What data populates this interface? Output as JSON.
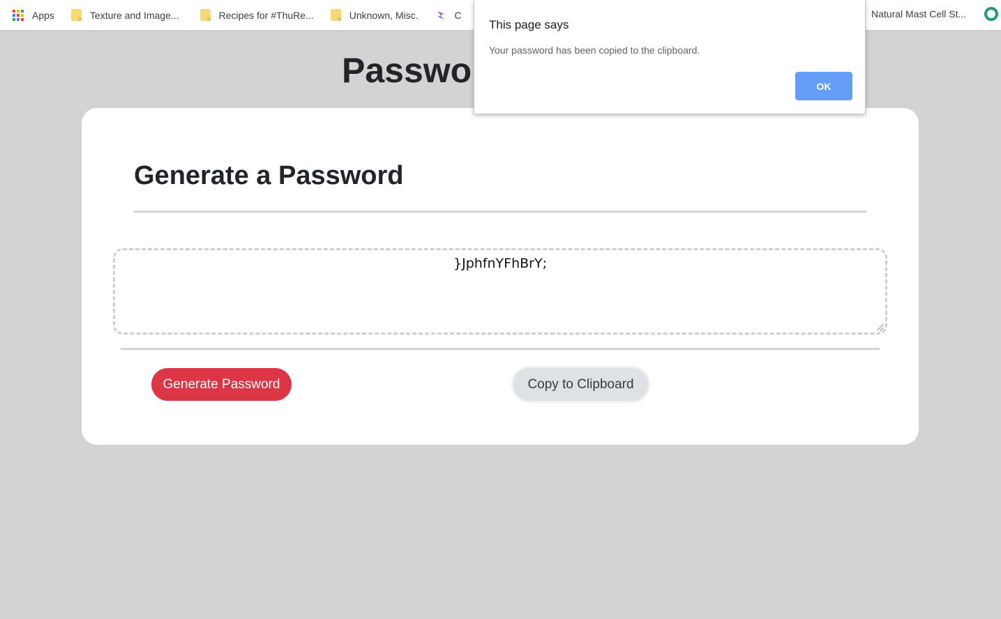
{
  "bookmarks": {
    "items": [
      {
        "label": "Apps",
        "icon": "apps-grid-icon"
      },
      {
        "label": "Texture and Image...",
        "icon": "folder-icon"
      },
      {
        "label": "Recipes for #ThuRe...",
        "icon": "folder-icon"
      },
      {
        "label": "Unknown, Misc.",
        "icon": "folder-icon"
      },
      {
        "label": "C",
        "icon": "bookmark-logo-icon"
      }
    ],
    "right_item": {
      "label": "Natural Mast Cell St...",
      "icon": "site-ring-icon"
    }
  },
  "page": {
    "title": "Password Generator",
    "title_visible": "Passworc"
  },
  "card": {
    "title": "Generate a Password",
    "password_value": "}JphfnYFhBrY;",
    "generate_label": "Generate Password",
    "copy_label": "Copy to Clipboard"
  },
  "dialog": {
    "title": "This page says",
    "message": "Your password has been copied to the clipboard.",
    "ok_label": "OK"
  },
  "colors": {
    "background": "#d3d3d3",
    "generate_button": "#dc3545",
    "copy_button": "#dee2e6",
    "dialog_ok": "#669df6"
  }
}
